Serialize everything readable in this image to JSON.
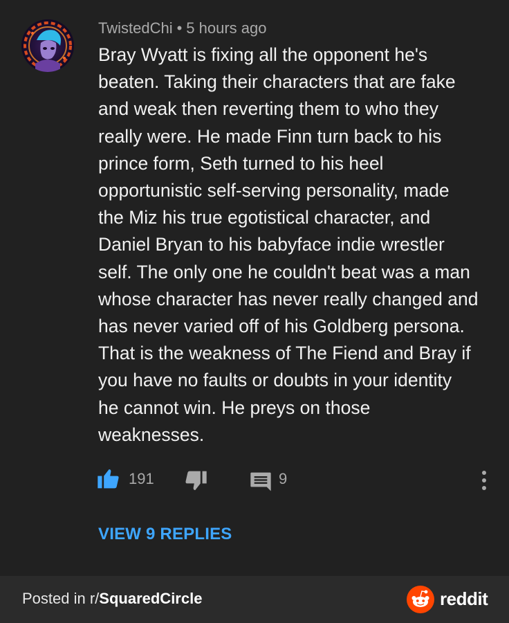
{
  "comment": {
    "author": "TwistedChi",
    "separator": "•",
    "time_ago": "5 hours ago",
    "body_lines": [
      "Bray Wyatt is fixing all the opponent he's",
      "beaten. Taking their characters that are fake",
      "and weak then reverting them to who they",
      "really were. He made Finn turn back to his",
      "prince form, Seth turned to his heel",
      "opportunistic self-serving personality, made",
      "the Miz his true egotistical character, and",
      "Daniel Bryan to his babyface indie wrestler",
      "self. The only one he couldn't beat was a man",
      "whose character has never really changed and",
      "has never varied off of his Goldberg persona.",
      "That is the weakness of The Fiend and Bray if",
      "you have no faults or doubts in your identity",
      "he cannot win. He preys on those",
      "weaknesses."
    ],
    "like_count": "191",
    "reply_count": "9",
    "view_replies_label": "VIEW 9 REPLIES"
  },
  "footer": {
    "posted_in_prefix": "Posted in r/",
    "subreddit": "SquaredCircle",
    "brand": "reddit"
  },
  "colors": {
    "background": "#212121",
    "footer_background": "#2b2b2b",
    "link_blue": "#3ea6ff",
    "like_blue": "#3ea6ff",
    "reddit_orange": "#ff4500",
    "secondary_text": "#aaaaaa"
  },
  "icons": {
    "like": "thumbs-up-icon",
    "dislike": "thumbs-down-icon",
    "reply": "comment-bubble-icon",
    "more": "vertical-dots-icon",
    "brand": "reddit-alien-icon"
  }
}
